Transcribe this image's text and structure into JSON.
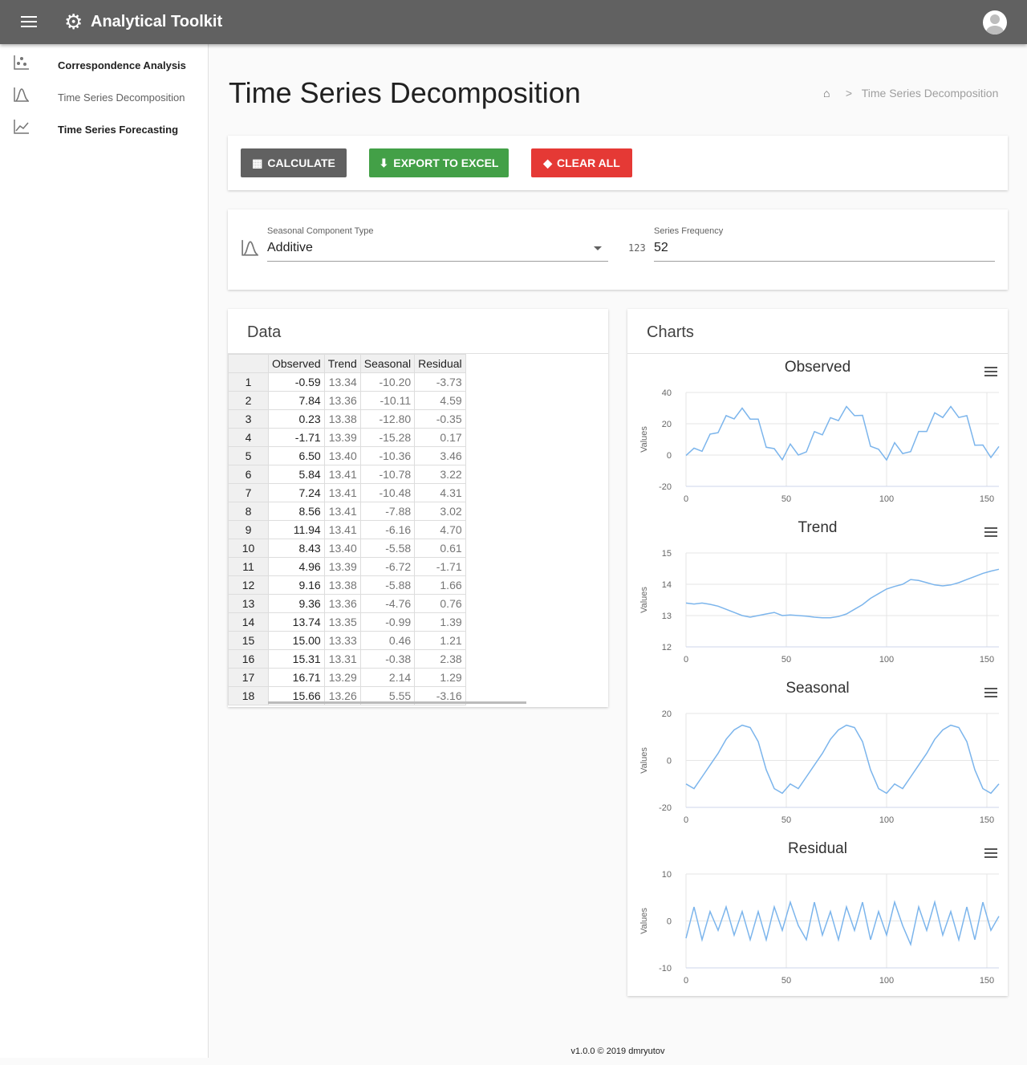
{
  "header": {
    "title": "Analytical Toolkit",
    "menu_icon": "hamburger-icon",
    "logo_icon": "gear-icon",
    "avatar_icon": "account-circle-icon"
  },
  "sidebar": {
    "items": [
      {
        "label": "Correspondence Analysis",
        "icon": "scatter-plot-icon"
      },
      {
        "label": "Time Series Decomposition",
        "icon": "bell-curve-icon",
        "active": true
      },
      {
        "label": "Time Series Forecasting",
        "icon": "line-chart-icon"
      }
    ]
  },
  "page": {
    "title": "Time Series Decomposition",
    "breadcrumb": {
      "separator": ">",
      "current": "Time Series Decomposition"
    }
  },
  "toolbar": {
    "calculate": "CALCULATE",
    "export": "EXPORT TO EXCEL",
    "clear": "CLEAR ALL",
    "colors": {
      "calculate": "#616161",
      "export": "#43a047",
      "clear": "#e53935"
    }
  },
  "settings": {
    "seasonal_label": "Seasonal Component Type",
    "seasonal_value": "Additive",
    "frequency_label": "Series Frequency",
    "frequency_value": "52",
    "frequency_icon_text": "123"
  },
  "data_card": {
    "title": "Data",
    "columns": [
      "Observed",
      "Trend",
      "Seasonal",
      "Residual"
    ],
    "rows": [
      [
        "1",
        "-0.59",
        "13.34",
        "-10.20",
        "-3.73"
      ],
      [
        "2",
        "7.84",
        "13.36",
        "-10.11",
        "4.59"
      ],
      [
        "3",
        "0.23",
        "13.38",
        "-12.80",
        "-0.35"
      ],
      [
        "4",
        "-1.71",
        "13.39",
        "-15.28",
        "0.17"
      ],
      [
        "5",
        "6.50",
        "13.40",
        "-10.36",
        "3.46"
      ],
      [
        "6",
        "5.84",
        "13.41",
        "-10.78",
        "3.22"
      ],
      [
        "7",
        "7.24",
        "13.41",
        "-10.48",
        "4.31"
      ],
      [
        "8",
        "8.56",
        "13.41",
        "-7.88",
        "3.02"
      ],
      [
        "9",
        "11.94",
        "13.41",
        "-6.16",
        "4.70"
      ],
      [
        "10",
        "8.43",
        "13.40",
        "-5.58",
        "0.61"
      ],
      [
        "11",
        "4.96",
        "13.39",
        "-6.72",
        "-1.71"
      ],
      [
        "12",
        "9.16",
        "13.38",
        "-5.88",
        "1.66"
      ],
      [
        "13",
        "9.36",
        "13.36",
        "-4.76",
        "0.76"
      ],
      [
        "14",
        "13.74",
        "13.35",
        "-0.99",
        "1.39"
      ],
      [
        "15",
        "15.00",
        "13.33",
        "0.46",
        "1.21"
      ],
      [
        "16",
        "15.31",
        "13.31",
        "-0.38",
        "2.38"
      ],
      [
        "17",
        "16.71",
        "13.29",
        "2.14",
        "1.29"
      ],
      [
        "18",
        "15.66",
        "13.26",
        "5.55",
        "-3.16"
      ]
    ]
  },
  "charts_card": {
    "title": "Charts"
  },
  "chart_data": [
    {
      "type": "line",
      "title": "Observed",
      "ylabel": "Values",
      "ylim": [
        -20,
        40
      ],
      "yticks": [
        -20,
        0,
        20,
        40
      ],
      "xlim": [
        0,
        156
      ],
      "xticks": [
        0,
        50,
        100,
        150
      ],
      "grid": true,
      "color": "#7cb5ec",
      "x": [
        0,
        4,
        8,
        12,
        16,
        20,
        24,
        28,
        32,
        36,
        40,
        44,
        48,
        52,
        56,
        60,
        64,
        68,
        72,
        76,
        80,
        84,
        88,
        92,
        96,
        100,
        104,
        108,
        112,
        116,
        120,
        124,
        128,
        132,
        136,
        140,
        144,
        148,
        152,
        156
      ],
      "y": [
        -0.3,
        4.4,
        2.4,
        13.4,
        14.3,
        25.2,
        23.1,
        30,
        23,
        23,
        5,
        4.1,
        -3,
        7,
        0,
        2,
        15,
        12.9,
        23.9,
        22,
        31,
        25.2,
        25.4,
        5.6,
        3.7,
        -3.2,
        7.9,
        1,
        2.2,
        15.1,
        15.1,
        27,
        24,
        31,
        24,
        25.2,
        6.3,
        6.4,
        -1.6,
        5.5
      ]
    },
    {
      "type": "line",
      "title": "Trend",
      "ylabel": "Values",
      "ylim": [
        12,
        15
      ],
      "yticks": [
        12,
        13,
        14,
        15
      ],
      "xlim": [
        0,
        156
      ],
      "xticks": [
        0,
        50,
        100,
        150
      ],
      "grid": true,
      "color": "#7cb5ec",
      "x": [
        0,
        4,
        8,
        12,
        16,
        20,
        24,
        28,
        32,
        36,
        40,
        44,
        48,
        52,
        56,
        60,
        64,
        68,
        72,
        76,
        80,
        84,
        88,
        92,
        96,
        100,
        104,
        108,
        112,
        116,
        120,
        124,
        128,
        132,
        136,
        140,
        144,
        148,
        152,
        156
      ],
      "y": [
        13.4,
        13.37,
        13.4,
        13.36,
        13.3,
        13.2,
        13.1,
        13.0,
        12.95,
        13.0,
        13.05,
        13.1,
        13.0,
        13.02,
        13.0,
        12.98,
        12.95,
        12.93,
        12.93,
        12.97,
        13.05,
        13.2,
        13.35,
        13.55,
        13.7,
        13.85,
        13.93,
        14.0,
        14.15,
        14.12,
        14.05,
        13.98,
        13.95,
        13.98,
        14.05,
        14.15,
        14.25,
        14.35,
        14.42,
        14.48
      ]
    },
    {
      "type": "line",
      "title": "Seasonal",
      "ylabel": "Values",
      "ylim": [
        -20,
        20
      ],
      "yticks": [
        -20,
        0,
        20
      ],
      "xlim": [
        0,
        156
      ],
      "xticks": [
        0,
        50,
        100,
        150
      ],
      "grid": true,
      "color": "#7cb5ec",
      "x": [
        0,
        4,
        8,
        12,
        16,
        20,
        24,
        28,
        32,
        36,
        40,
        44,
        48,
        52,
        56,
        60,
        64,
        68,
        72,
        76,
        80,
        84,
        88,
        92,
        96,
        100,
        104,
        108,
        112,
        116,
        120,
        124,
        128,
        132,
        136,
        140,
        144,
        148,
        152,
        156
      ],
      "y": [
        -10,
        -12,
        -7,
        -2,
        3,
        9,
        13,
        15,
        14,
        8,
        -4,
        -12,
        -14,
        -10,
        -12,
        -7,
        -2,
        3,
        9,
        13,
        15,
        14,
        8,
        -4,
        -12,
        -14,
        -10,
        -12,
        -7,
        -2,
        3,
        9,
        13,
        15,
        14,
        8,
        -4,
        -12,
        -14,
        -10
      ]
    },
    {
      "type": "line",
      "title": "Residual",
      "ylabel": "Values",
      "ylim": [
        -10,
        10
      ],
      "yticks": [
        -10,
        0,
        10
      ],
      "xlim": [
        0,
        156
      ],
      "xticks": [
        0,
        50,
        100,
        150
      ],
      "grid": true,
      "color": "#7cb5ec",
      "x": [
        0,
        4,
        8,
        12,
        16,
        20,
        24,
        28,
        32,
        36,
        40,
        44,
        48,
        52,
        56,
        60,
        64,
        68,
        72,
        76,
        80,
        84,
        88,
        92,
        96,
        100,
        104,
        108,
        112,
        116,
        120,
        124,
        128,
        132,
        136,
        140,
        144,
        148,
        152,
        156
      ],
      "y": [
        -3.7,
        3,
        -4,
        2,
        -2,
        3,
        -3,
        2,
        -4,
        2,
        -4,
        3,
        -2,
        4,
        -1,
        -4,
        4,
        -3,
        2,
        -4,
        3,
        -2,
        4,
        -4,
        2,
        -3,
        4,
        -1,
        -5,
        3,
        -2,
        4,
        -3,
        2,
        -4,
        3,
        -4,
        4,
        -2,
        1
      ]
    }
  ],
  "footer": "v1.0.0 © 2019 dmryutov"
}
